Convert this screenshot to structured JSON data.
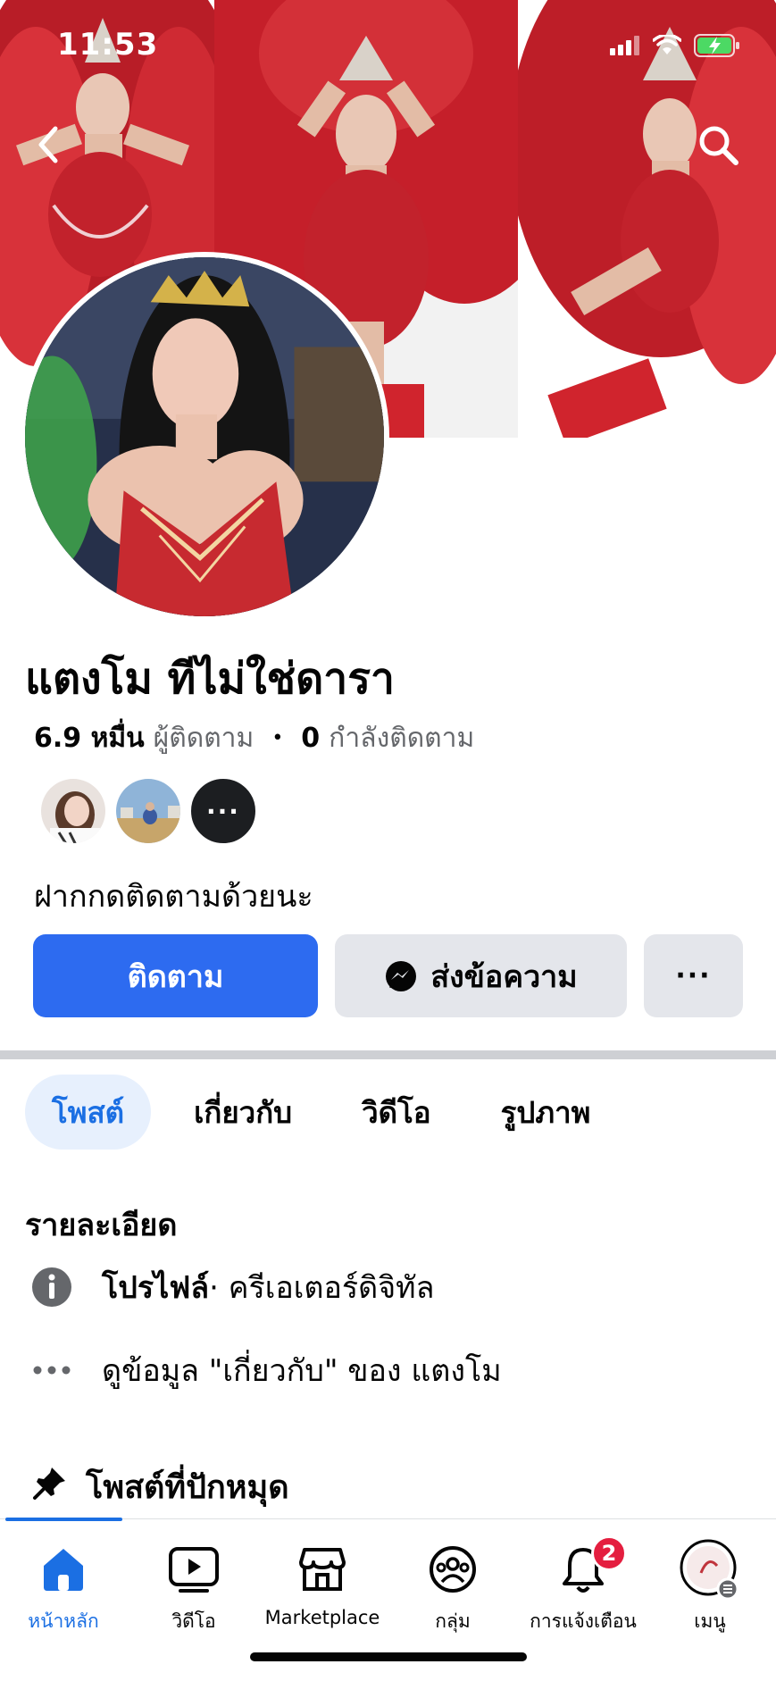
{
  "status_bar": {
    "time": "11:53"
  },
  "colors": {
    "accent": "#2d6bf0",
    "tab_active_bg": "#e7f0fd",
    "tab_active_text": "#1b6fe3",
    "badge": "#e41e3f",
    "button_gray": "#e4e6eb",
    "cover_red": "#c8232c"
  },
  "header": {
    "back_icon": "chevron-left-icon",
    "search_icon": "search-icon"
  },
  "profile": {
    "name": "แตงโม ทีไม่ใช่ดารา",
    "followers_count": "6.9 หมื่น",
    "followers_label": "ผู้ติดตาม",
    "following_count": "0",
    "following_label": "กำลังติดตาม",
    "more_mutuals": "···",
    "bio": "ฝากกดติดตามด้วยนะ"
  },
  "actions": {
    "follow_label": "ติดตาม",
    "message_label": "ส่งข้อความ",
    "more_label": "···"
  },
  "tabs": [
    {
      "label": "โพสต์",
      "active": true
    },
    {
      "label": "เกี่ยวกับ",
      "active": false
    },
    {
      "label": "วิดีโอ",
      "active": false
    },
    {
      "label": "รูปภาพ",
      "active": false
    }
  ],
  "details": {
    "title": "รายละเอียด",
    "profile_type_bold": "โปรไฟล์",
    "profile_type_rest": " · ครีเอเตอร์ดิจิทัล",
    "about_link": "ดูข้อมูล \"เกี่ยวกับ\" ของ แตงโม"
  },
  "pinned": {
    "label": "โพสต์ที่ปักหมุด"
  },
  "bottom_nav": [
    {
      "label": "หน้าหลัก",
      "icon": "home-icon",
      "active": true
    },
    {
      "label": "วิดีโอ",
      "icon": "video-icon",
      "active": false
    },
    {
      "label": "Marketplace",
      "icon": "marketplace-icon",
      "active": false
    },
    {
      "label": "กลุ่ม",
      "icon": "groups-icon",
      "active": false
    },
    {
      "label": "การแจ้งเตือน",
      "icon": "bell-icon",
      "active": false,
      "badge": "2"
    },
    {
      "label": "เมนู",
      "icon": "menu-avatar-icon",
      "active": false
    }
  ]
}
